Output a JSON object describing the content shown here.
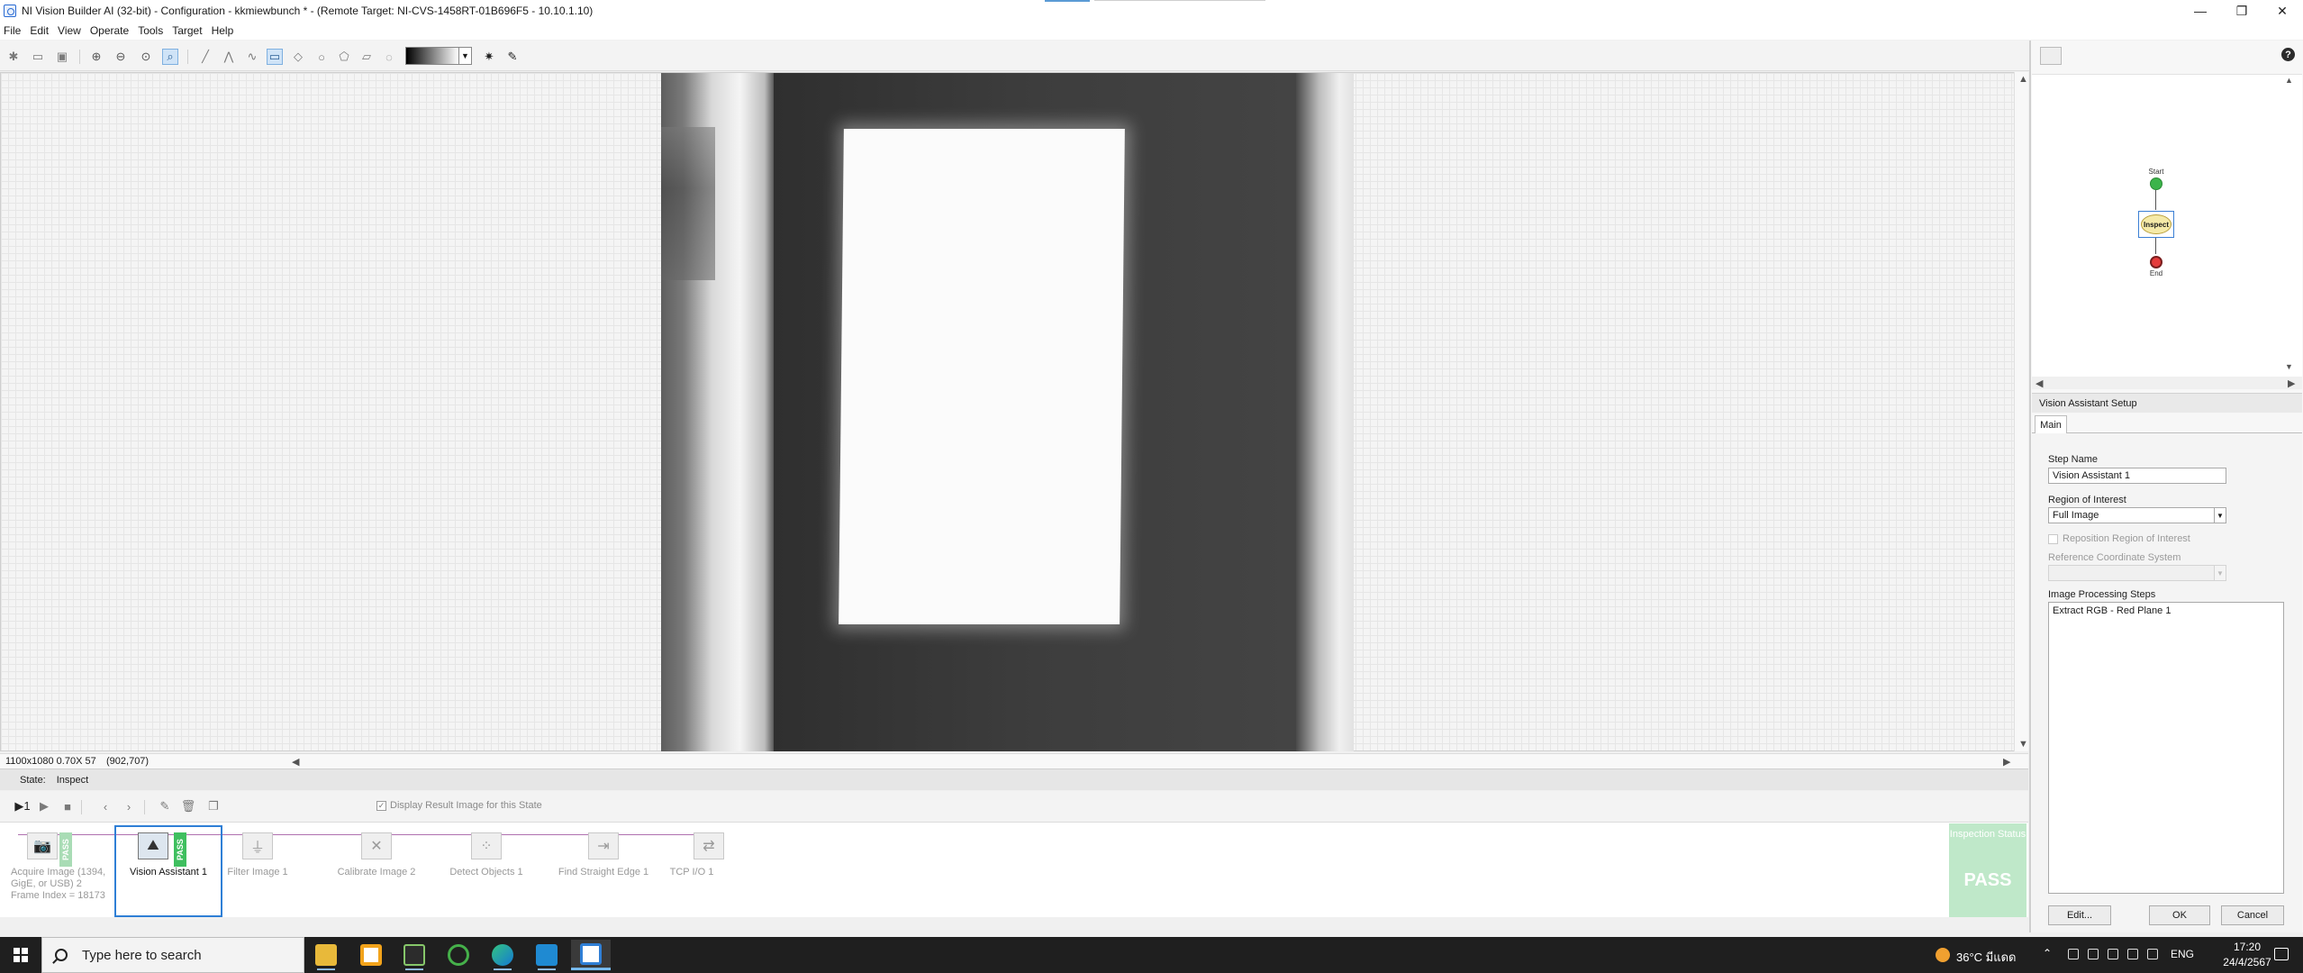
{
  "window": {
    "title": "NI Vision Builder AI (32-bit) - Configuration - kkmiewbunch * - (Remote Target: NI-CVS-1458RT-01B696F5 - 10.10.1.10)"
  },
  "menu": [
    "File",
    "Edit",
    "View",
    "Operate",
    "Tools",
    "Target",
    "Help"
  ],
  "toolbar_icons": [
    "new-icon",
    "open-icon",
    "save-icon",
    "zoom-in-icon",
    "zoom-out-icon",
    "zoom-fit-icon",
    "zoom-tool-icon",
    "line-tool-icon",
    "polyline-tool-icon",
    "freeline-tool-icon",
    "rectangle-tool-icon",
    "rotated-rect-tool-icon",
    "oval-tool-icon",
    "polygon-tool-icon",
    "freehand-tool-icon",
    "annulus-tool-icon",
    "palette-gradient",
    "brightness-icon",
    "eyedropper-icon"
  ],
  "viewer": {
    "image_info": "1100x1080 0.70X 57",
    "cursor_coord": "(902,707)"
  },
  "state": {
    "label": "State:",
    "value": "Inspect"
  },
  "steps_toolbar": {
    "display_result": "Display Result Image for this State",
    "display_result_checked": true
  },
  "steps": [
    {
      "name": "Acquire Image (1394, GigE, or USB) 2",
      "sub": "Frame Index = 18173",
      "icon": "camera-icon",
      "status": "PASS"
    },
    {
      "name": "Vision Assistant 1",
      "icon": "vision-assistant-icon",
      "status": "PASS",
      "selected": true
    },
    {
      "name": "Filter Image 1",
      "icon": "filter-icon"
    },
    {
      "name": "Calibrate Image 2",
      "icon": "calibrate-icon"
    },
    {
      "name": "Detect Objects 1",
      "icon": "detect-objects-icon"
    },
    {
      "name": "Find Straight Edge 1",
      "icon": "straight-edge-icon"
    },
    {
      "name": "TCP I/O 1",
      "icon": "tcp-io-icon"
    }
  ],
  "inspection_status": {
    "label": "Inspection Status",
    "result": "PASS"
  },
  "diagram": {
    "start": "Start",
    "inspect": "Inspect",
    "end": "End"
  },
  "setup": {
    "header": "Vision Assistant Setup",
    "tab": "Main",
    "step_name_label": "Step Name",
    "step_name_value": "Vision Assistant 1",
    "roi_label": "Region of Interest",
    "roi_value": "Full Image",
    "reposition_label": "Reposition Region of Interest",
    "ref_coord_label": "Reference Coordinate System",
    "ips_label": "Image Processing Steps",
    "ips_items": [
      "Extract RGB - Red Plane 1"
    ],
    "edit_button": "Edit...",
    "ok_button": "OK",
    "cancel_button": "Cancel"
  },
  "taskbar": {
    "search_placeholder": "Type here to search",
    "weather": "36°C มีแดด",
    "language": "ENG",
    "time": "17:20",
    "date": "24/4/2567",
    "apps": [
      "file-explorer-icon",
      "store-icon",
      "app-icon",
      "refresh-app-icon",
      "edge-icon",
      "vscode-icon",
      "vision-builder-icon"
    ]
  }
}
